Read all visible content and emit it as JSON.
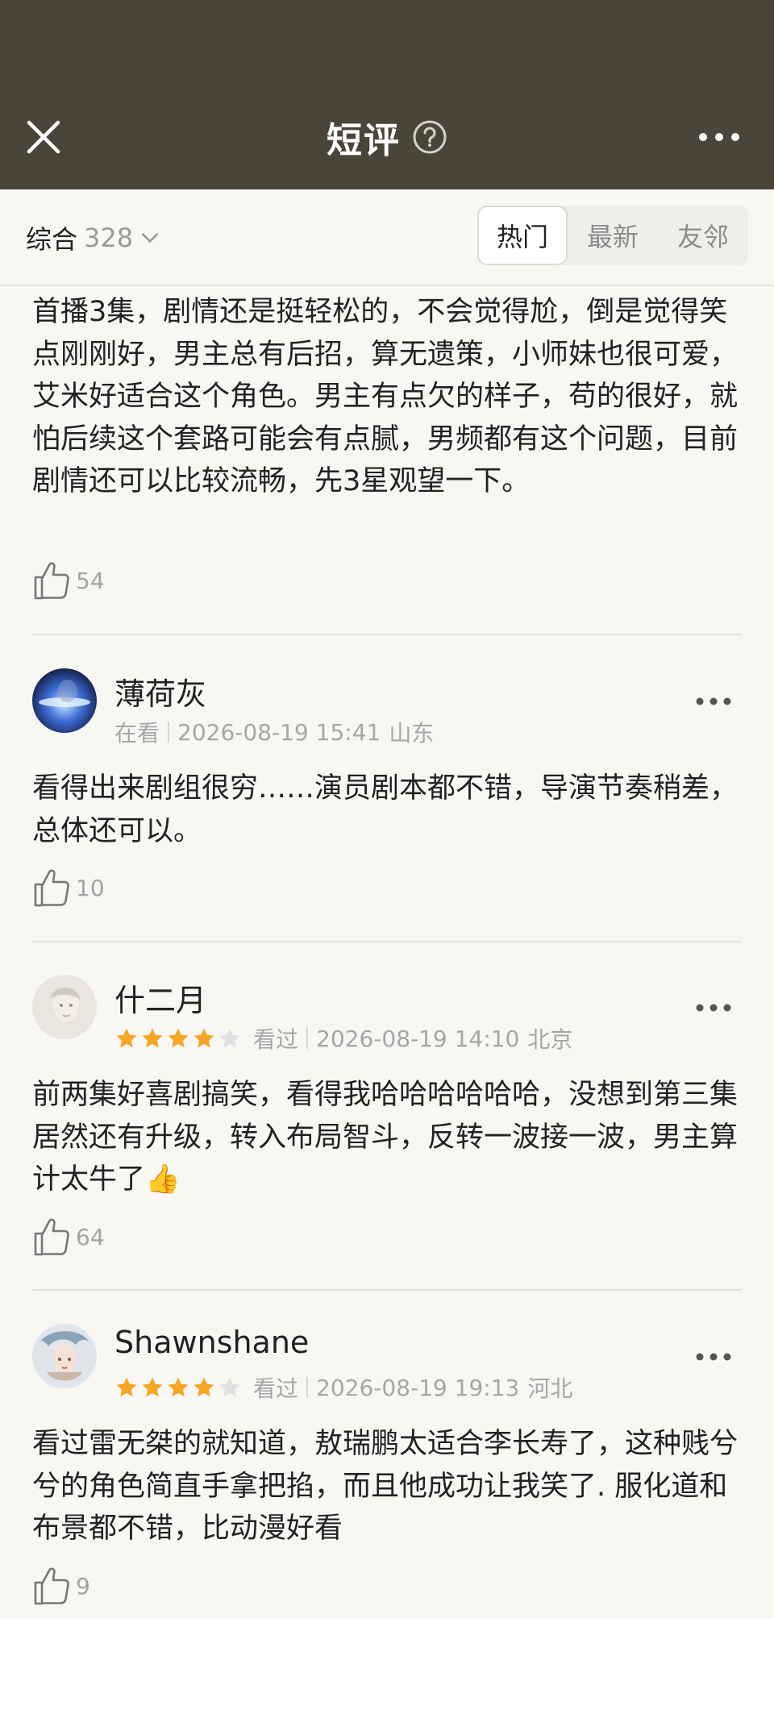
{
  "header": {
    "title": "短评",
    "close_icon": "close-icon",
    "help_icon": "help-circle-icon",
    "more_icon": "more-horizontal-icon",
    "background_color": "#4a4538"
  },
  "filter": {
    "sort_label": "综合",
    "sort_count": "328",
    "tabs": [
      {
        "label": "热门",
        "active": true
      },
      {
        "label": "最新",
        "active": false
      },
      {
        "label": "友邻",
        "active": false
      }
    ]
  },
  "comments": [
    {
      "text": "首播3集，剧情还是挺轻松的，不会觉得尬，倒是觉得笑点刚刚好，男主总有后招，算无遗策，小师妹也很可爱，艾米好适合这个角色。男主有点欠的样子，苟的很好，就怕后续这个套路可能会有点腻，男频都有这个问题，目前剧情还可以比较流畅，先3星观望一下。",
      "likes": "54"
    },
    {
      "username": "薄荷灰",
      "status": "在看",
      "datetime": "2026-08-19 15:41",
      "location": "山东",
      "text": "看得出来剧组很穷……演员剧本都不错，导演节奏稍差，总体还可以。",
      "likes": "10"
    },
    {
      "username": "什二月",
      "rating": 4,
      "status": "看过",
      "datetime": "2026-08-19 14:10",
      "location": "北京",
      "text": "前两集好喜剧搞笑，看得我哈哈哈哈哈哈，没想到第三集居然还有升级，转入布局智斗，反转一波接一波，男主算计太牛了👍",
      "likes": "64"
    },
    {
      "username": "Shawnshane",
      "rating": 4,
      "status": "看过",
      "datetime": "2026-08-19 19:13",
      "location": "河北",
      "text": "看过雷无桀的就知道，敖瑞鹏太适合李长寿了，这种贱兮兮的角色简直手拿把掐，而且他成功让我笑了. 服化道和布景都不错，比动漫好看",
      "likes": "9"
    }
  ],
  "colors": {
    "star": "#f5a623",
    "star_empty": "#e0e0e0",
    "page_bg": "#f8f7f4"
  }
}
